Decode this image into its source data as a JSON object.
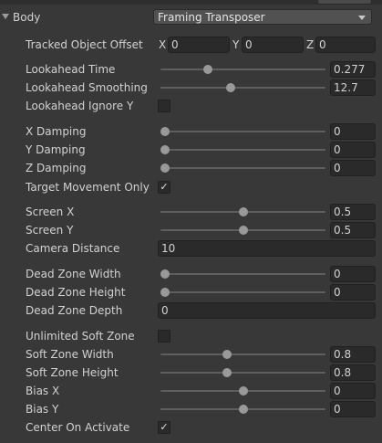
{
  "header": {
    "section_label": "Body",
    "mode_dropdown": "Framing Transposer"
  },
  "tracked_offset": {
    "label": "Tracked Object Offset",
    "x_label": "X",
    "x": "0",
    "y_label": "Y",
    "y": "0",
    "z_label": "Z",
    "z": "0"
  },
  "lookahead_time": {
    "label": "Lookahead Time",
    "value": "0.277",
    "slider_fraction": 0.277
  },
  "lookahead_smoothing": {
    "label": "Lookahead Smoothing",
    "value": "12.7",
    "slider_fraction": 0.423
  },
  "lookahead_ignore_y": {
    "label": "Lookahead Ignore Y",
    "checked": false
  },
  "x_damping": {
    "label": "X Damping",
    "value": "0",
    "slider_fraction": 0
  },
  "y_damping": {
    "label": "Y Damping",
    "value": "0",
    "slider_fraction": 0
  },
  "z_damping": {
    "label": "Z Damping",
    "value": "0",
    "slider_fraction": 0
  },
  "target_movement_only": {
    "label": "Target Movement Only",
    "checked": true
  },
  "screen_x": {
    "label": "Screen X",
    "value": "0.5",
    "slider_fraction": 0.5
  },
  "screen_y": {
    "label": "Screen Y",
    "value": "0.5",
    "slider_fraction": 0.5
  },
  "camera_distance": {
    "label": "Camera Distance",
    "value": "10"
  },
  "dead_zone_width": {
    "label": "Dead Zone Width",
    "value": "0",
    "slider_fraction": 0
  },
  "dead_zone_height": {
    "label": "Dead Zone Height",
    "value": "0",
    "slider_fraction": 0
  },
  "dead_zone_depth": {
    "label": "Dead Zone Depth",
    "value": "0"
  },
  "unlimited_soft_zone": {
    "label": "Unlimited Soft Zone",
    "checked": false
  },
  "soft_zone_width": {
    "label": "Soft Zone Width",
    "value": "0.8",
    "slider_fraction": 0.4
  },
  "soft_zone_height": {
    "label": "Soft Zone Height",
    "value": "0.8",
    "slider_fraction": 0.4
  },
  "bias_x": {
    "label": "Bias X",
    "value": "0",
    "slider_fraction": 0.5
  },
  "bias_y": {
    "label": "Bias Y",
    "value": "0",
    "slider_fraction": 0.5
  },
  "center_on_activate": {
    "label": "Center On Activate",
    "checked": true
  },
  "check_glyph": "✓"
}
